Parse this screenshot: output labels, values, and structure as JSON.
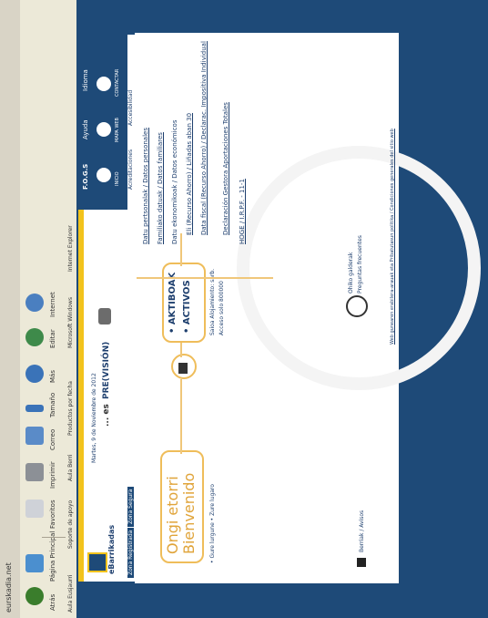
{
  "browser": {
    "title": "eurskadia.net",
    "toolbar": {
      "back": "Atrás",
      "next": "Página Principal",
      "favoritos": "Favoritos",
      "imprimir": "Imprimir",
      "correo": "Correo",
      "fuente": "Tamaño",
      "mas": "Más",
      "editar": "Editar",
      "internet": "Internet"
    },
    "links": [
      "Aula Eusjaurri",
      "Soporte de apoyo",
      "Aula Berri",
      "Productos por fecha",
      "Microsoft Windows",
      "Internet Explorer"
    ]
  },
  "header": {
    "logo_text": "eBarrikadas",
    "date": "Martes, 9 de Noviembre de 2012",
    "slogan_prefix": "... es",
    "slogan_brand": "PRE(VISIÓN)",
    "nav_left": [
      "Zona Registrada",
      "Zona Segura"
    ],
    "nav_right": [
      "F.O.G.S",
      "Ayuda",
      "Idioma"
    ],
    "icons": [
      "INICIO",
      "MAPA WEB",
      "CONTACTAR"
    ],
    "sub_links": [
      "Acreditaciones",
      "Accesibilidad"
    ]
  },
  "main": {
    "welcome": [
      "Ongi etorri",
      "Bienvenido"
    ],
    "lang_note": "• Gure lurgune • Zure lugaro",
    "activos": [
      "• AKTIBOAK",
      "• ACTIVOS"
    ],
    "info_note": [
      "Saioa Alojamiento: sarb.",
      "Acceso solo 800000"
    ],
    "links": [
      "Datu pertsonalak / Datos personales",
      "Familiako datuak / Datos familiares",
      "Datu ekonomikoak / Datos económicos",
      "Eli (Recurso Ahorro) / Liñadas aban 30",
      "Data fiscal (Recurso Ahorro) / Declarac. Impositiva Individual",
      "Declaración Gestora Aportaciones Totales",
      "HOGE / I.R.P.F. - 11-1"
    ],
    "help": [
      "Ohiko galderak",
      "Preguntas frecuentes"
    ],
    "footer_link": "Berriak / Avisos",
    "bottom_note": "Web gunearen erabilera-arauak eta Pribatutasun politika / Condiciones generales del sitio web"
  }
}
